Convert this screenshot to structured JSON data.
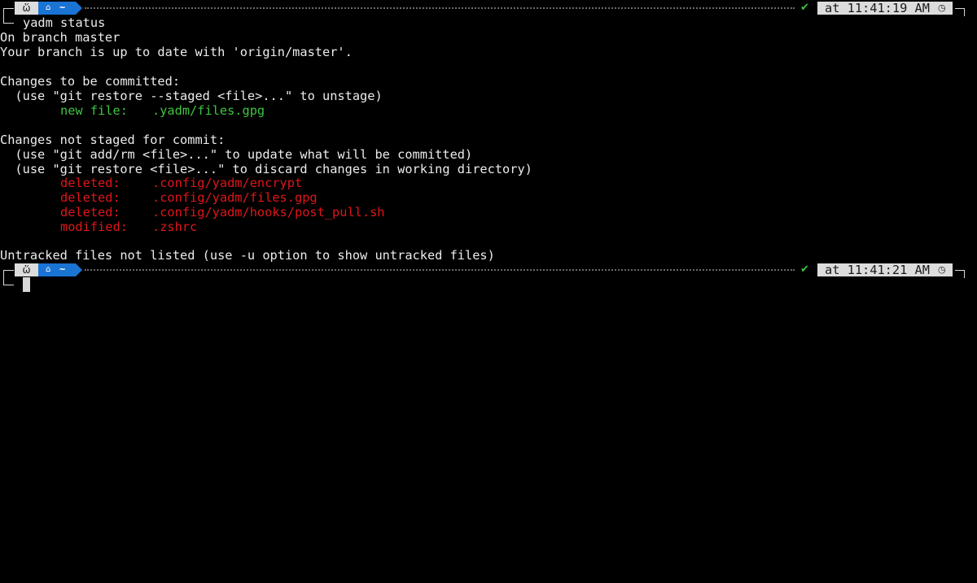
{
  "colors": {
    "background": "#000000",
    "foreground": "#ececec",
    "staged": "#3fc43f",
    "unstaged": "#e0151a",
    "dir_segment": "#1a74d4",
    "segment_light": "#dcdcdc",
    "status_ok": "#3fc43f"
  },
  "prompts": [
    {
      "os_icon": "debian-swirl-icon",
      "os_glyph": "ὥ",
      "dir_icon": "home-icon",
      "dir_glyph": "⌂",
      "dir": "~",
      "status_glyph": "✔",
      "time": "at 11:41:19 AM",
      "clock_icon": "clock-icon",
      "clock_glyph": "◷",
      "command": "yadm status"
    },
    {
      "os_icon": "debian-swirl-icon",
      "os_glyph": "ὥ",
      "dir_icon": "home-icon",
      "dir_glyph": "⌂",
      "dir": "~",
      "status_glyph": "✔",
      "time": "at 11:41:21 AM",
      "clock_icon": "clock-icon",
      "clock_glyph": "◷",
      "command": ""
    }
  ],
  "output": {
    "l1": "On branch master",
    "l2": "Your branch is up to date with 'origin/master'.",
    "l3": "Changes to be committed:",
    "l4": "  (use \"git restore --staged <file>...\" to unstage)",
    "staged": [
      {
        "status": "new file:",
        "path": ".yadm/files.gpg"
      }
    ],
    "l5": "Changes not staged for commit:",
    "l6": "  (use \"git add/rm <file>...\" to update what will be committed)",
    "l7": "  (use \"git restore <file>...\" to discard changes in working directory)",
    "unstaged": [
      {
        "status": "deleted:",
        "path": ".config/yadm/encrypt"
      },
      {
        "status": "deleted:",
        "path": ".config/yadm/files.gpg"
      },
      {
        "status": "deleted:",
        "path": ".config/yadm/hooks/post_pull.sh"
      },
      {
        "status": "modified:",
        "path": ".zshrc"
      }
    ],
    "l8": "Untracked files not listed (use -u option to show untracked files)"
  }
}
